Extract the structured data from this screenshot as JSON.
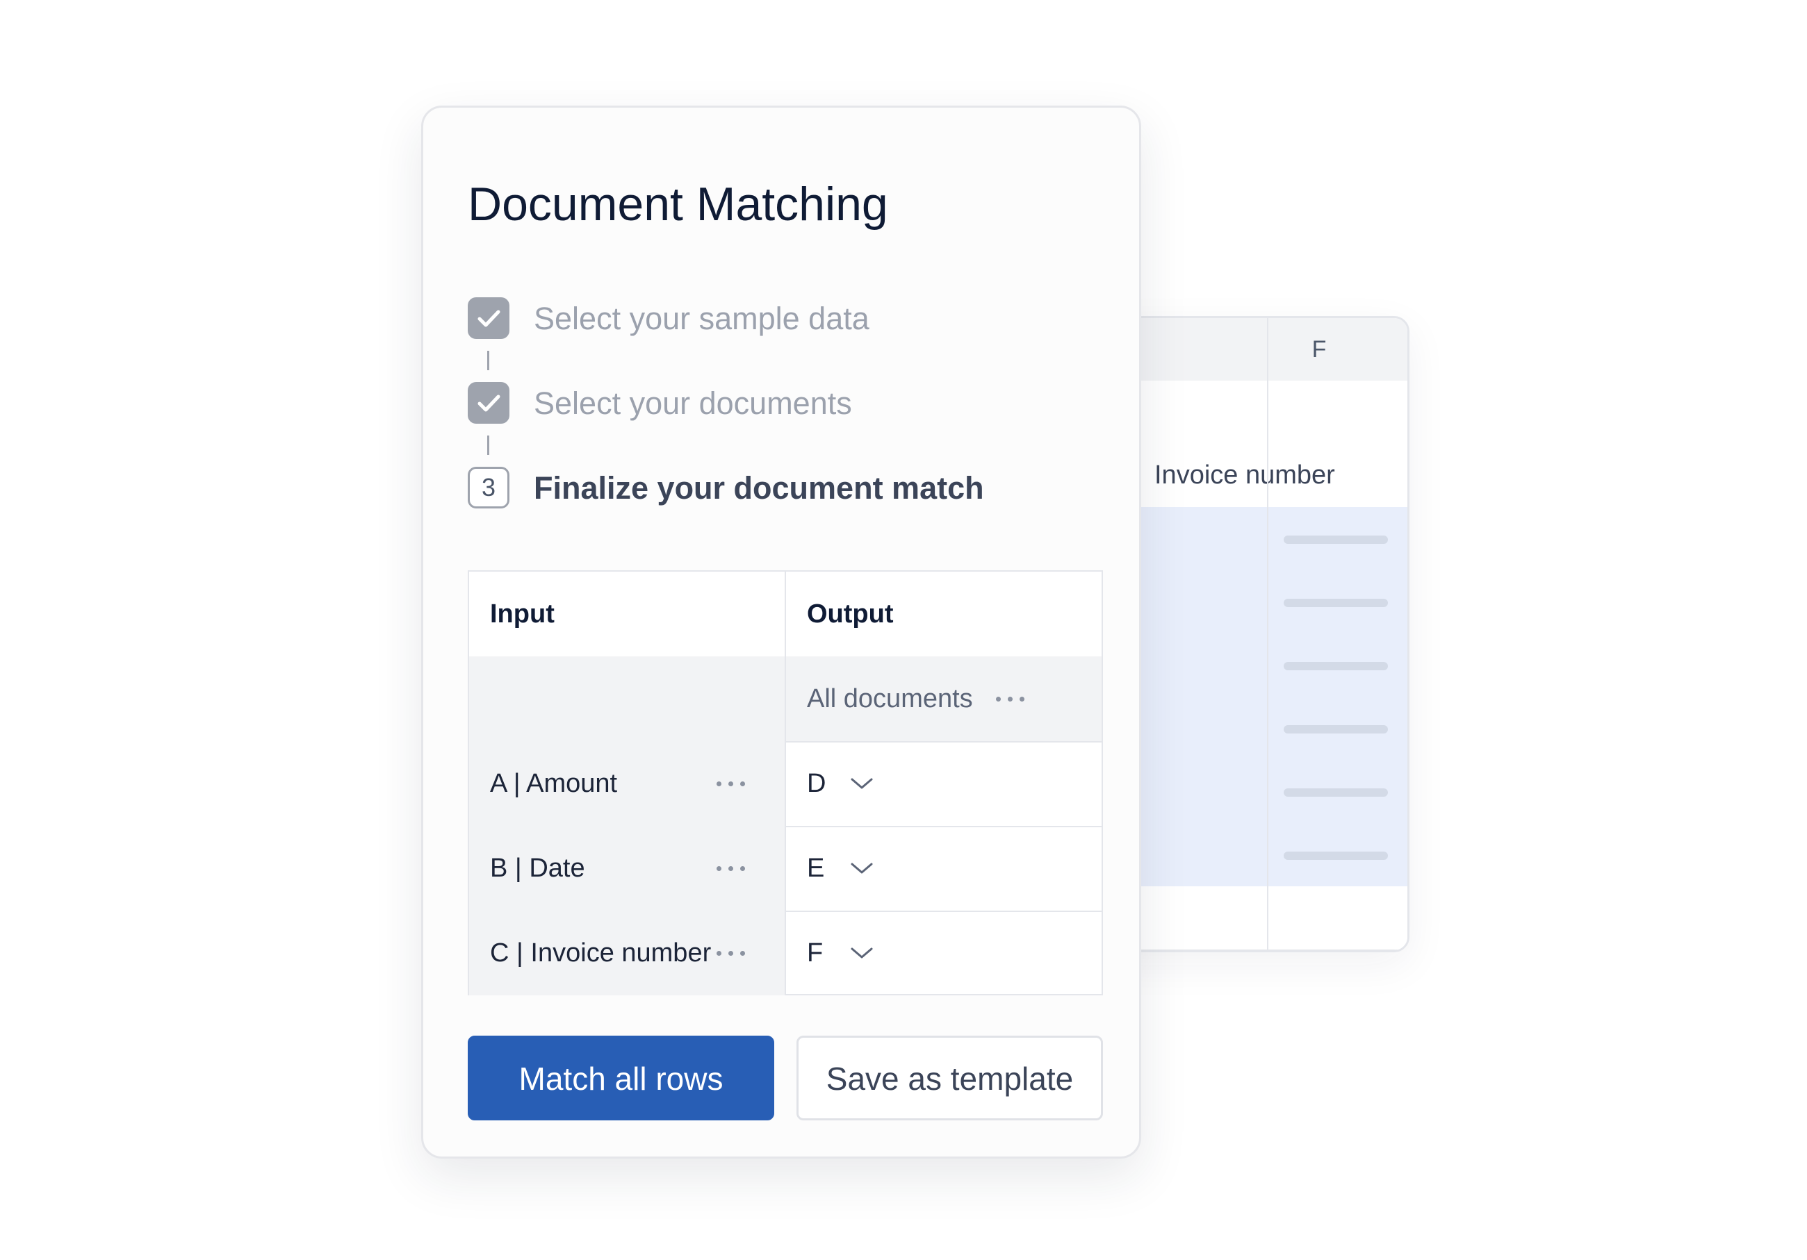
{
  "dialog": {
    "title": "Document Matching"
  },
  "steps": [
    {
      "label": "Select your sample data",
      "state": "completed"
    },
    {
      "label": "Select your documents",
      "state": "completed"
    },
    {
      "number": "3",
      "label": "Finalize your document match",
      "state": "active"
    }
  ],
  "mapping_table": {
    "headers": {
      "input": "Input",
      "output": "Output"
    },
    "all_documents_label": "All documents",
    "rows": [
      {
        "input": "A | Amount",
        "output": "D"
      },
      {
        "input": "B | Date",
        "output": "E"
      },
      {
        "input": "C | Invoice number",
        "output": "F"
      }
    ]
  },
  "buttons": {
    "primary": "Match all rows",
    "secondary": "Save as template"
  },
  "background_sheet": {
    "column_letter": "F",
    "column_header": "Invoice number",
    "highlighted_rows": 6
  },
  "colors": {
    "primary_button": "#285eb5",
    "checkbox_completed": "#9ea3ad",
    "row_highlight": "#e8eefb",
    "title_text": "#0f1b35"
  },
  "icons": {
    "step_completed": "checkmark-icon",
    "row_menu": "ellipsis-icon",
    "output_select": "chevron-down-icon"
  }
}
